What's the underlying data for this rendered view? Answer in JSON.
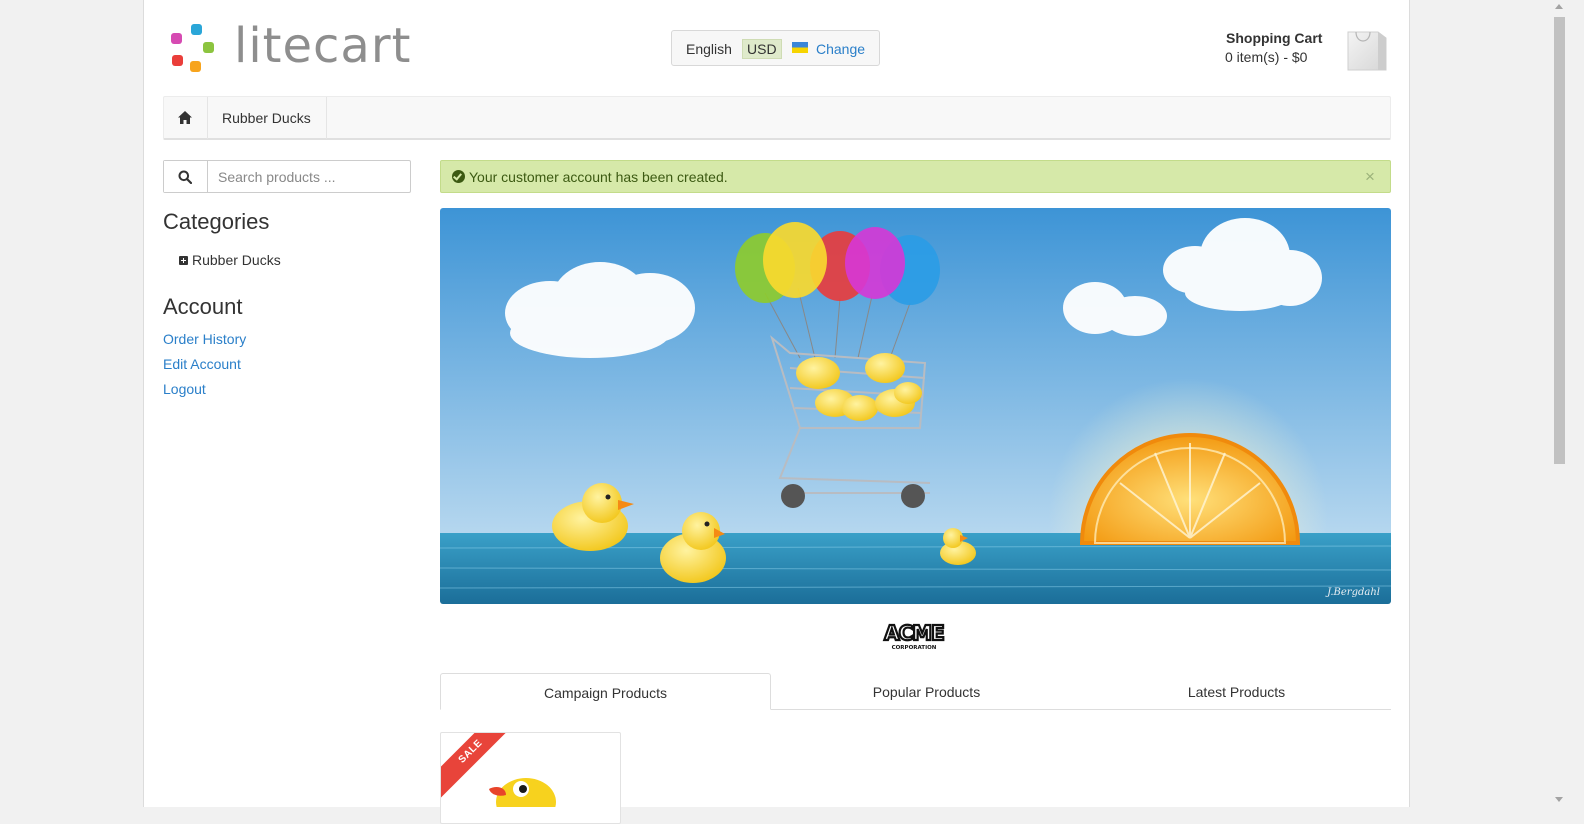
{
  "header": {
    "logo_text": "litecart",
    "region": {
      "language": "English",
      "currency": "USD",
      "change_label": "Change"
    },
    "cart": {
      "title": "Shopping Cart",
      "summary": "0 item(s) - $0"
    }
  },
  "breadcrumb": {
    "home_icon": "home-icon",
    "current": "Rubber Ducks"
  },
  "sidebar": {
    "search": {
      "placeholder": "Search products ..."
    },
    "categories_heading": "Categories",
    "categories": [
      {
        "label": "Rubber Ducks"
      }
    ],
    "account_heading": "Account",
    "account_links": [
      {
        "label": "Order History"
      },
      {
        "label": "Edit Account"
      },
      {
        "label": "Logout"
      }
    ]
  },
  "notice": {
    "text": "Your customer account has been created.",
    "close": "×"
  },
  "banner": {
    "signature": "J.Bergdahl"
  },
  "brand": {
    "logo_text": "ACME",
    "logo_subtext": "CORPORATION"
  },
  "tabs": [
    {
      "label": "Campaign Products",
      "active": true
    },
    {
      "label": "Popular Products",
      "active": false
    },
    {
      "label": "Latest Products",
      "active": false
    }
  ],
  "product": {
    "badge": "SALE"
  },
  "colors": {
    "link": "#2a7fc9",
    "notice_bg": "#d6e9a9",
    "sale_badge": "#e8443a"
  }
}
